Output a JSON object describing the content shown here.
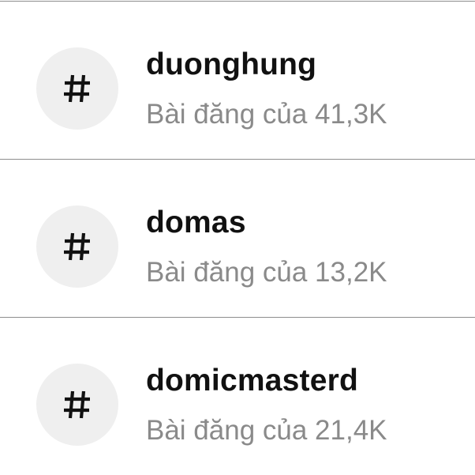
{
  "hashtag_results": [
    {
      "icon": "hashtag-icon",
      "name": "duonghung",
      "posts": "Bài đăng của 41,3K"
    },
    {
      "icon": "hashtag-icon",
      "name": "domas",
      "posts": "Bài đăng của 13,2K"
    },
    {
      "icon": "hashtag-icon",
      "name": "domicmasterd",
      "posts": "Bài đăng của 21,4K"
    }
  ],
  "colors": {
    "icon_background": "#efefef",
    "name_text": "#111111",
    "count_text": "#8a8a8a",
    "divider": "#8e8e8e"
  }
}
